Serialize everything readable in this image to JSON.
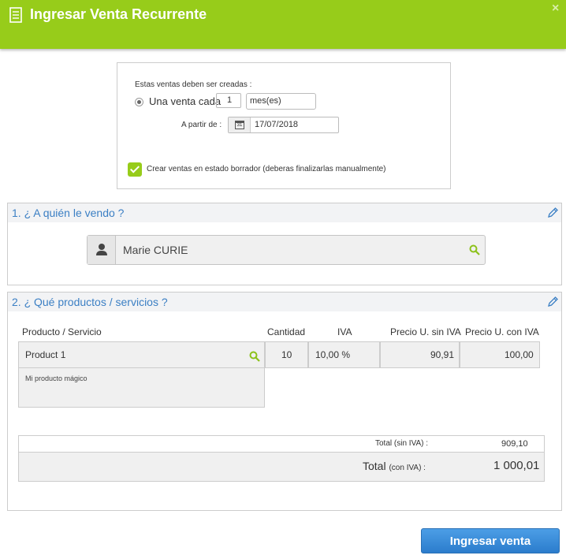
{
  "header": {
    "title": "Ingresar Venta Recurrente",
    "icon": "invoice-icon",
    "close_icon": "close-icon",
    "close_glyph": "×"
  },
  "recurrence": {
    "prompt": "Estas ventas deben ser creadas :",
    "radio_label": "Una venta cada",
    "count": "1",
    "unit": "mes(es)",
    "from_label": "A partir de :",
    "date": "17/07/2018",
    "calendar_day": "31",
    "draft_checked": true,
    "draft_label": "Crear ventas en estado borrador (deberas finalizarlas manualmente)"
  },
  "client_section": {
    "title": "1. ¿ A quién le vendo ?",
    "client_name": "Marie CURIE"
  },
  "products_section": {
    "title": "2. ¿ Qué productos / servicios ?",
    "columns": [
      "Producto / Servicio",
      "Cantidad",
      "IVA",
      "Precio U. sin IVA",
      "Precio U. con IVA"
    ],
    "row": {
      "product": "Product 1",
      "description": "Mi producto mágico",
      "quantity": "10",
      "vat": "10,00 %",
      "price_excl": "90,91",
      "price_incl": "100,00"
    },
    "totals": {
      "excl_label": "Total (sin IVA) :",
      "excl_value": "909,10",
      "incl_label": "Total",
      "incl_suffix": "(con IVA) :",
      "incl_value": "1 000,01"
    }
  },
  "submit_label": "Ingresar venta",
  "colors": {
    "header": "#97cc1a",
    "accent_blue": "#3b7fc4",
    "button": "#2b7ccc",
    "check": "#97cc1a"
  }
}
